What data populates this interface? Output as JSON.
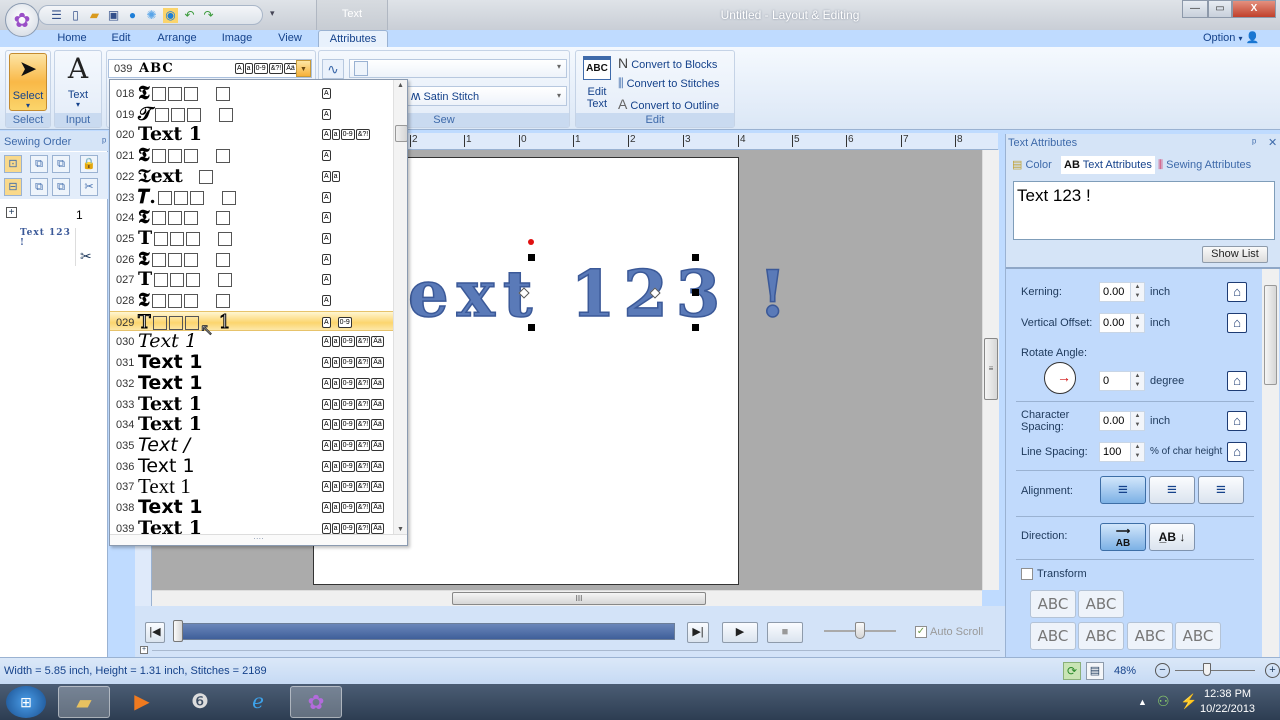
{
  "window": {
    "title": "Untitled - Layout & Editing",
    "context_tab": "Text",
    "controls": {
      "minimize": "—",
      "restore": "▭",
      "close": "X"
    }
  },
  "quick_access": [
    "list-icon",
    "new-file-icon",
    "open-folder-icon",
    "save-icon",
    "stitch-simulator-icon",
    "realistic-view-icon",
    "color-icon",
    "undo-icon",
    "redo-icon",
    "customize-icon"
  ],
  "ribbon": {
    "tabs": [
      "Home",
      "Edit",
      "Arrange",
      "Image",
      "View",
      "Attributes"
    ],
    "active_tab": "Attributes",
    "option_label": "Option",
    "select_group": {
      "button": "Select",
      "label": "Select"
    },
    "input_group": {
      "button": "Text",
      "label": "Input"
    },
    "font_combo": {
      "number": "039",
      "sample": "ABC",
      "badges": [
        "A",
        "a",
        "0-9",
        "&?!",
        "Ää"
      ]
    },
    "sew_group": {
      "label": "Sew",
      "stitch_type": "Satin Stitch"
    },
    "edit_group": {
      "label": "Edit",
      "edit_text": {
        "icon_text": "ABC",
        "line1": "Edit",
        "line2": "Text"
      },
      "links": [
        "Convert to Blocks",
        "Convert to Stitches",
        "Convert to Outline"
      ]
    }
  },
  "font_list": {
    "selected": "029",
    "items": [
      {
        "num": "018",
        "sample": "𝕿",
        "boxes": "3+1",
        "badges": [
          "A"
        ]
      },
      {
        "num": "019",
        "sample": "𝒯",
        "boxes": "3+1",
        "badges": [
          "A"
        ]
      },
      {
        "num": "020",
        "sample": "Text  1",
        "boxes": "",
        "badges": [
          "A",
          "a",
          "0-9",
          "&?!"
        ]
      },
      {
        "num": "021",
        "sample": "𝕿",
        "boxes": "3+1",
        "badges": [
          "A"
        ]
      },
      {
        "num": "022",
        "sample": "𝔗ext",
        "boxes": "1",
        "badges": [
          "A",
          "a"
        ]
      },
      {
        "num": "023",
        "sample": "𝑻.",
        "boxes": "3+1",
        "badges": [
          "A"
        ]
      },
      {
        "num": "024",
        "sample": "𝕿",
        "boxes": "3+1",
        "badges": [
          "A"
        ]
      },
      {
        "num": "025",
        "sample": "T",
        "boxes": "3+1",
        "badges": [
          "A"
        ]
      },
      {
        "num": "026",
        "sample": "𝕿",
        "boxes": "3+1",
        "badges": [
          "A"
        ]
      },
      {
        "num": "027",
        "sample": "T",
        "boxes": "3+1",
        "badges": [
          "A"
        ]
      },
      {
        "num": "028",
        "sample": "𝕿",
        "boxes": "3+1",
        "badges": [
          "A"
        ]
      },
      {
        "num": "029",
        "sample": "T",
        "boxes": "3+1",
        "badges": [
          "A",
          "0-9"
        ]
      },
      {
        "num": "030",
        "sample": "Text 1",
        "boxes": "",
        "badges": [
          "A",
          "a",
          "0-9",
          "&?!",
          "Ää"
        ]
      },
      {
        "num": "031",
        "sample": "Text 1",
        "boxes": "",
        "badges": [
          "A",
          "a",
          "0-9",
          "&?!",
          "Ää"
        ]
      },
      {
        "num": "032",
        "sample": "Text 1",
        "boxes": "",
        "badges": [
          "A",
          "a",
          "0-9",
          "&?!",
          "Ää"
        ]
      },
      {
        "num": "033",
        "sample": "Text 1",
        "boxes": "",
        "badges": [
          "A",
          "a",
          "0-9",
          "&?!",
          "Ää"
        ]
      },
      {
        "num": "034",
        "sample": "Text 1",
        "boxes": "",
        "badges": [
          "A",
          "a",
          "0-9",
          "&?!",
          "Ää"
        ]
      },
      {
        "num": "035",
        "sample": "Text /",
        "boxes": "",
        "badges": [
          "A",
          "a",
          "0-9",
          "&?!",
          "Ää"
        ]
      },
      {
        "num": "036",
        "sample": "Text 1",
        "boxes": "",
        "badges": [
          "A",
          "a",
          "0-9",
          "&?!",
          "Ää"
        ]
      },
      {
        "num": "037",
        "sample": "Text 1",
        "boxes": "",
        "badges": [
          "A",
          "a",
          "0-9",
          "&?!",
          "Ää"
        ]
      },
      {
        "num": "038",
        "sample": "Text 1",
        "boxes": "",
        "badges": [
          "A",
          "a",
          "0-9",
          "&?!",
          "Ää"
        ]
      },
      {
        "num": "039",
        "sample": "Text 1",
        "boxes": "",
        "badges": [
          "A",
          "a",
          "0-9",
          "&?!",
          "Ää"
        ]
      }
    ]
  },
  "sewing_order": {
    "title": "Sewing Order",
    "item_number": "1",
    "item_preview": "Text 123 !"
  },
  "ruler": {
    "ticks": [
      "2",
      "1",
      "0",
      "1",
      "2",
      "3",
      "4",
      "5",
      "6",
      "7",
      "8"
    ]
  },
  "canvas": {
    "embroidery_text": "ext 123 !"
  },
  "playback": {
    "auto_scroll_label": "Auto Scroll",
    "auto_scroll_checked": true,
    "progress": 0.0
  },
  "text_attributes": {
    "title": "Text Attributes",
    "tabs": [
      "Color",
      "Text Attributes",
      "Sewing Attributes"
    ],
    "active_tab": "Text Attributes",
    "text_value": "Text 123 !",
    "show_list": "Show List",
    "kerning": {
      "label": "Kerning:",
      "value": "0.00",
      "unit": "inch"
    },
    "vertical_offset": {
      "label": "Vertical Offset:",
      "value": "0.00",
      "unit": "inch"
    },
    "rotate_angle": {
      "label": "Rotate Angle:",
      "value": "0",
      "unit": "degree"
    },
    "character_spacing": {
      "label1": "Character",
      "label2": "Spacing:",
      "value": "0.00",
      "unit": "inch"
    },
    "line_spacing": {
      "label": "Line Spacing:",
      "value": "100",
      "unit": "% of char height"
    },
    "alignment": {
      "label": "Alignment:",
      "selected": "left"
    },
    "direction": {
      "label": "Direction:",
      "selected": "horizontal",
      "h_text": "AB",
      "v_text": "A B"
    },
    "transform": {
      "label": "Transform",
      "checked": false,
      "samples": [
        "ABC",
        "ABC",
        "ABC",
        "ABC",
        "ABC",
        "ABC"
      ]
    }
  },
  "status": {
    "text": "Width = 5.85 inch, Height = 1.31 inch, Stitches = 2189",
    "zoom": "48%"
  },
  "taskbar": {
    "items": [
      "start-orb",
      "file-explorer",
      "media-player",
      "stitch-app",
      "internet-explorer",
      "embroidery-app"
    ],
    "time": "12:38 PM",
    "date": "10/22/2013"
  }
}
